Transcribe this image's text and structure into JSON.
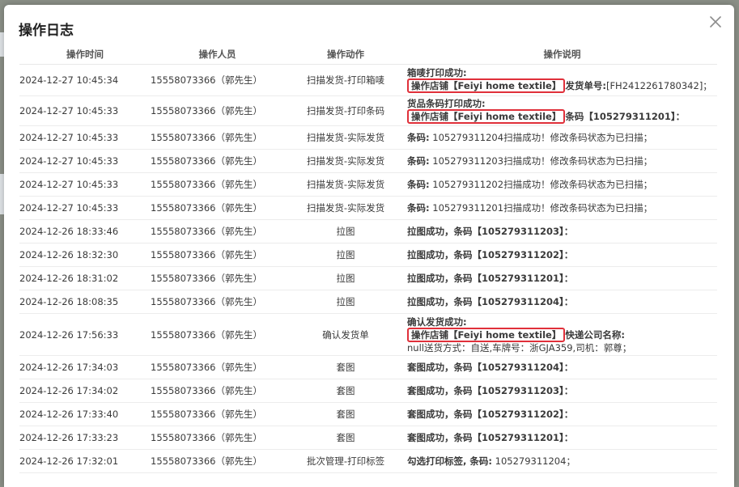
{
  "dialog": {
    "title": "操作日志"
  },
  "columns": [
    "操作时间",
    "操作人员",
    "操作动作",
    "操作说明"
  ],
  "rows": [
    {
      "time": "2024-12-27 10:45:34",
      "operator": "15558073366（郭先生）",
      "action": "扫描发货-打印箱唛",
      "desc": [
        [
          {
            "t": "箱唛打印成功:",
            "b": true
          }
        ],
        [
          {
            "t": "操作店铺【Feiyi home textile】",
            "hl": true
          },
          {
            "t": "发货单号:",
            "b": true
          },
          {
            "t": "[FH2412261780342]；"
          }
        ]
      ]
    },
    {
      "time": "2024-12-27 10:45:33",
      "operator": "15558073366（郭先生）",
      "action": "扫描发货-打印条码",
      "desc": [
        [
          {
            "t": "货品条码打印成功:",
            "b": true
          }
        ],
        [
          {
            "t": "操作店铺【Feiyi home textile】",
            "hl": true
          },
          {
            "t": "条码【105279311201】：",
            "b": true
          }
        ]
      ]
    },
    {
      "time": "2024-12-27 10:45:33",
      "operator": "15558073366（郭先生）",
      "action": "扫描发货-实际发货",
      "desc": [
        [
          {
            "t": "条码:",
            "b": true
          },
          {
            "t": " 105279311204扫描成功！修改条码状态为已扫描；"
          }
        ]
      ]
    },
    {
      "time": "2024-12-27 10:45:33",
      "operator": "15558073366（郭先生）",
      "action": "扫描发货-实际发货",
      "desc": [
        [
          {
            "t": "条码:",
            "b": true
          },
          {
            "t": " 105279311203扫描成功！修改条码状态为已扫描；"
          }
        ]
      ]
    },
    {
      "time": "2024-12-27 10:45:33",
      "operator": "15558073366（郭先生）",
      "action": "扫描发货-实际发货",
      "desc": [
        [
          {
            "t": "条码:",
            "b": true
          },
          {
            "t": " 105279311202扫描成功！修改条码状态为已扫描；"
          }
        ]
      ]
    },
    {
      "time": "2024-12-27 10:45:33",
      "operator": "15558073366（郭先生）",
      "action": "扫描发货-实际发货",
      "desc": [
        [
          {
            "t": "条码:",
            "b": true
          },
          {
            "t": " 105279311201扫描成功！修改条码状态为已扫描；"
          }
        ]
      ]
    },
    {
      "time": "2024-12-26 18:33:46",
      "operator": "15558073366（郭先生）",
      "action": "拉图",
      "desc": [
        [
          {
            "t": "拉图成功，条码【105279311203】：",
            "b": true
          }
        ]
      ]
    },
    {
      "time": "2024-12-26 18:32:30",
      "operator": "15558073366（郭先生）",
      "action": "拉图",
      "desc": [
        [
          {
            "t": "拉图成功，条码【105279311202】：",
            "b": true
          }
        ]
      ]
    },
    {
      "time": "2024-12-26 18:31:02",
      "operator": "15558073366（郭先生）",
      "action": "拉图",
      "desc": [
        [
          {
            "t": "拉图成功，条码【105279311201】：",
            "b": true
          }
        ]
      ]
    },
    {
      "time": "2024-12-26 18:08:35",
      "operator": "15558073366（郭先生）",
      "action": "拉图",
      "desc": [
        [
          {
            "t": "拉图成功，条码【105279311204】：",
            "b": true
          }
        ]
      ]
    },
    {
      "time": "2024-12-26 17:56:33",
      "operator": "15558073366（郭先生）",
      "action": "确认发货单",
      "desc": [
        [
          {
            "t": "确认发货成功:",
            "b": true
          }
        ],
        [
          {
            "t": "操作店铺【Feiyi home textile】",
            "hl": true
          },
          {
            "t": "快递公司名称:",
            "b": true
          }
        ],
        [
          {
            "t": "null送货方式：自送,车牌号：浙GJA359,司机：郭尊；"
          }
        ]
      ]
    },
    {
      "time": "2024-12-26 17:34:03",
      "operator": "15558073366（郭先生）",
      "action": "套图",
      "desc": [
        [
          {
            "t": "套图成功，条码【105279311204】：",
            "b": true
          }
        ]
      ]
    },
    {
      "time": "2024-12-26 17:34:02",
      "operator": "15558073366（郭先生）",
      "action": "套图",
      "desc": [
        [
          {
            "t": "套图成功，条码【105279311203】：",
            "b": true
          }
        ]
      ]
    },
    {
      "time": "2024-12-26 17:33:40",
      "operator": "15558073366（郭先生）",
      "action": "套图",
      "desc": [
        [
          {
            "t": "套图成功，条码【105279311202】：",
            "b": true
          }
        ]
      ]
    },
    {
      "time": "2024-12-26 17:33:23",
      "operator": "15558073366（郭先生）",
      "action": "套图",
      "desc": [
        [
          {
            "t": "套图成功，条码【105279311201】：",
            "b": true
          }
        ]
      ]
    },
    {
      "time": "2024-12-26 17:32:01",
      "operator": "15558073366（郭先生）",
      "action": "批次管理-打印标签",
      "desc": [
        [
          {
            "t": "勾选打印标签, 条码:",
            "b": true
          },
          {
            "t": " 105279311204；"
          }
        ]
      ]
    }
  ],
  "colors": {
    "highlight_border": "#e0303a",
    "backdrop": "#8a8f86"
  },
  "icons": {
    "close": "close-icon"
  }
}
